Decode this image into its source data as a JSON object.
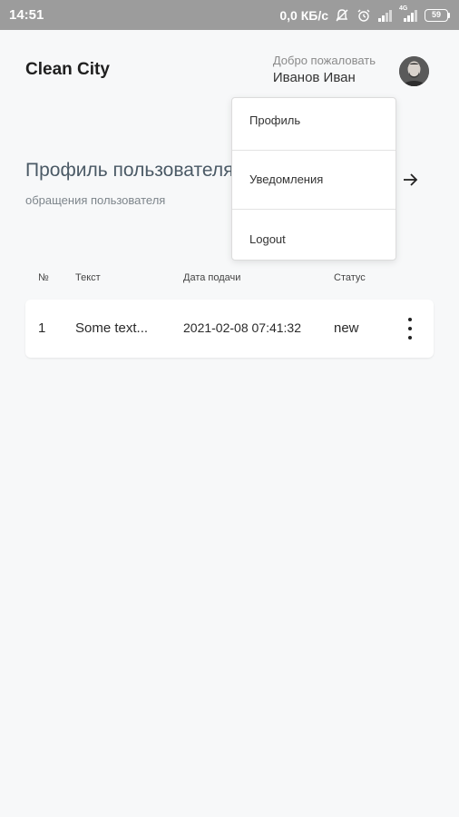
{
  "status_bar": {
    "time": "14:51",
    "speed": "0,0 КБ/с",
    "battery": "59",
    "network_label": "4G"
  },
  "header": {
    "brand": "Clean City",
    "welcome": "Добро пожаловать",
    "user_name": "Иванов Иван"
  },
  "section": {
    "title": "Профиль пользователя",
    "subtitle": "обращения пользователя"
  },
  "table": {
    "headers": [
      "№",
      "Текст",
      "Дата подачи",
      "Статус"
    ],
    "rows": [
      {
        "num": "1",
        "text": "Some text...",
        "date": "2021-02-08 07:41:32",
        "status": "new"
      }
    ]
  },
  "dropdown": {
    "items": [
      "Профиль",
      "Уведомления",
      "Logout"
    ]
  },
  "icons": {
    "mute": "bell-off-icon",
    "alarm": "alarm-clock-icon",
    "signal": "signal-icon",
    "battery": "battery-icon",
    "arrow": "arrow-right-icon",
    "menu": "more-vertical-icon",
    "avatar": "avatar"
  },
  "colors": {
    "status_bar": "#9c9c9c",
    "background": "#f7f8f9",
    "section_title": "#4b5a66"
  }
}
